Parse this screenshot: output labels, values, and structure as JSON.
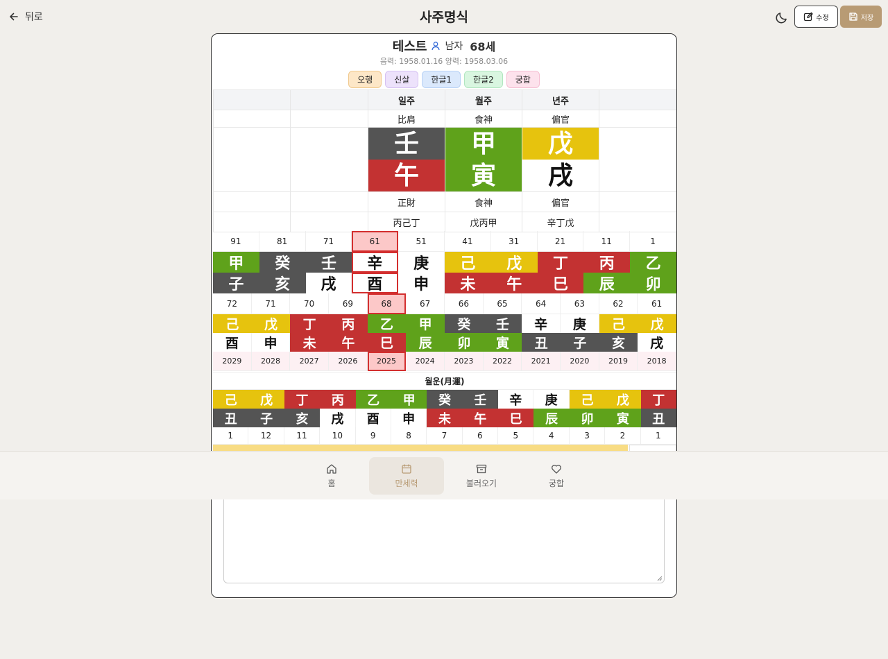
{
  "header": {
    "back_label": "뒤로",
    "title": "사주명식",
    "edit_label": "수정",
    "save_label": "저장"
  },
  "profile": {
    "name": "테스트",
    "gender": "남자",
    "age": "68세",
    "dates": "음력: 1958.01.16 양력: 1958.03.06"
  },
  "tabs": [
    {
      "label": "오행",
      "bg": "#fde7c7",
      "border": "#f0c98d"
    },
    {
      "label": "신살",
      "bg": "#ede2fb",
      "border": "#d6c2f2"
    },
    {
      "label": "한글1",
      "bg": "#dbe9fc",
      "border": "#b8d2f5"
    },
    {
      "label": "한글2",
      "bg": "#d9f6e0",
      "border": "#b2e6c0"
    },
    {
      "label": "궁합",
      "bg": "#fde2ec",
      "border": "#f5bed2"
    }
  ],
  "pillars": {
    "headers": [
      "",
      "",
      "일주",
      "월주",
      "년주",
      ""
    ],
    "top_gods": [
      "比肩",
      "食神",
      "偏官"
    ],
    "stems": [
      {
        "ch": "壬",
        "bg": "#545454",
        "fg": "#ffffff"
      },
      {
        "ch": "甲",
        "bg": "#5fa21b",
        "fg": "#ffffff"
      },
      {
        "ch": "戊",
        "bg": "#e6c30e",
        "fg": "#ffffff"
      }
    ],
    "branches": [
      {
        "ch": "午",
        "bg": "#c33232",
        "fg": "#ffffff"
      },
      {
        "ch": "寅",
        "bg": "#5fa21b",
        "fg": "#ffffff"
      },
      {
        "ch": "戌",
        "bg": "#ffffff",
        "fg": "#111111"
      }
    ],
    "bottom_gods": [
      "正財",
      "食神",
      "偏官"
    ],
    "hidden": [
      "丙己丁",
      "戊丙甲",
      "辛丁戊"
    ]
  },
  "daeun": {
    "ages": [
      "91",
      "81",
      "71",
      "61",
      "51",
      "41",
      "31",
      "21",
      "11",
      "1"
    ],
    "selected_index": 3,
    "stems": [
      {
        "ch": "甲",
        "bg": "#5fa21b",
        "fg": "#ffffff"
      },
      {
        "ch": "癸",
        "bg": "#545454",
        "fg": "#ffffff"
      },
      {
        "ch": "壬",
        "bg": "#545454",
        "fg": "#ffffff"
      },
      {
        "ch": "辛",
        "bg": "#ffffff",
        "fg": "#111111"
      },
      {
        "ch": "庚",
        "bg": "#ffffff",
        "fg": "#111111"
      },
      {
        "ch": "己",
        "bg": "#e6c30e",
        "fg": "#ffffff"
      },
      {
        "ch": "戊",
        "bg": "#e6c30e",
        "fg": "#ffffff"
      },
      {
        "ch": "丁",
        "bg": "#c33232",
        "fg": "#ffffff"
      },
      {
        "ch": "丙",
        "bg": "#c33232",
        "fg": "#ffffff"
      },
      {
        "ch": "乙",
        "bg": "#5fa21b",
        "fg": "#ffffff"
      }
    ],
    "branches": [
      {
        "ch": "子",
        "bg": "#545454",
        "fg": "#ffffff"
      },
      {
        "ch": "亥",
        "bg": "#545454",
        "fg": "#ffffff"
      },
      {
        "ch": "戌",
        "bg": "#ffffff",
        "fg": "#111111"
      },
      {
        "ch": "酉",
        "bg": "#ffffff",
        "fg": "#111111"
      },
      {
        "ch": "申",
        "bg": "#ffffff",
        "fg": "#111111"
      },
      {
        "ch": "未",
        "bg": "#c33232",
        "fg": "#ffffff"
      },
      {
        "ch": "午",
        "bg": "#c33232",
        "fg": "#ffffff"
      },
      {
        "ch": "巳",
        "bg": "#c33232",
        "fg": "#ffffff"
      },
      {
        "ch": "辰",
        "bg": "#5fa21b",
        "fg": "#ffffff"
      },
      {
        "ch": "卯",
        "bg": "#5fa21b",
        "fg": "#ffffff"
      }
    ]
  },
  "seun": {
    "ages": [
      "72",
      "71",
      "70",
      "69",
      "68",
      "67",
      "66",
      "65",
      "64",
      "63",
      "62",
      "61"
    ],
    "selected_index": 4,
    "stems": [
      {
        "ch": "己",
        "bg": "#e6c30e",
        "fg": "#ffffff"
      },
      {
        "ch": "戊",
        "bg": "#e6c30e",
        "fg": "#ffffff"
      },
      {
        "ch": "丁",
        "bg": "#c33232",
        "fg": "#ffffff"
      },
      {
        "ch": "丙",
        "bg": "#c33232",
        "fg": "#ffffff"
      },
      {
        "ch": "乙",
        "bg": "#5fa21b",
        "fg": "#ffffff"
      },
      {
        "ch": "甲",
        "bg": "#5fa21b",
        "fg": "#ffffff"
      },
      {
        "ch": "癸",
        "bg": "#545454",
        "fg": "#ffffff"
      },
      {
        "ch": "壬",
        "bg": "#545454",
        "fg": "#ffffff"
      },
      {
        "ch": "辛",
        "bg": "#ffffff",
        "fg": "#111111"
      },
      {
        "ch": "庚",
        "bg": "#ffffff",
        "fg": "#111111"
      },
      {
        "ch": "己",
        "bg": "#e6c30e",
        "fg": "#ffffff"
      },
      {
        "ch": "戊",
        "bg": "#e6c30e",
        "fg": "#ffffff"
      }
    ],
    "branches": [
      {
        "ch": "酉",
        "bg": "#ffffff",
        "fg": "#111111"
      },
      {
        "ch": "申",
        "bg": "#ffffff",
        "fg": "#111111"
      },
      {
        "ch": "未",
        "bg": "#c33232",
        "fg": "#ffffff"
      },
      {
        "ch": "午",
        "bg": "#c33232",
        "fg": "#ffffff"
      },
      {
        "ch": "巳",
        "bg": "#c33232",
        "fg": "#ffffff"
      },
      {
        "ch": "辰",
        "bg": "#5fa21b",
        "fg": "#ffffff"
      },
      {
        "ch": "卯",
        "bg": "#5fa21b",
        "fg": "#ffffff"
      },
      {
        "ch": "寅",
        "bg": "#5fa21b",
        "fg": "#ffffff"
      },
      {
        "ch": "丑",
        "bg": "#545454",
        "fg": "#ffffff"
      },
      {
        "ch": "子",
        "bg": "#545454",
        "fg": "#ffffff"
      },
      {
        "ch": "亥",
        "bg": "#545454",
        "fg": "#ffffff"
      },
      {
        "ch": "戌",
        "bg": "#ffffff",
        "fg": "#111111"
      }
    ],
    "years": [
      "2029",
      "2028",
      "2027",
      "2026",
      "2025",
      "2024",
      "2023",
      "2022",
      "2021",
      "2020",
      "2019",
      "2018"
    ]
  },
  "wolun": {
    "label": "월운(月運)",
    "stems": [
      {
        "ch": "己",
        "bg": "#e6c30e",
        "fg": "#ffffff"
      },
      {
        "ch": "戊",
        "bg": "#e6c30e",
        "fg": "#ffffff"
      },
      {
        "ch": "丁",
        "bg": "#c33232",
        "fg": "#ffffff"
      },
      {
        "ch": "丙",
        "bg": "#c33232",
        "fg": "#ffffff"
      },
      {
        "ch": "乙",
        "bg": "#5fa21b",
        "fg": "#ffffff"
      },
      {
        "ch": "甲",
        "bg": "#5fa21b",
        "fg": "#ffffff"
      },
      {
        "ch": "癸",
        "bg": "#545454",
        "fg": "#ffffff"
      },
      {
        "ch": "壬",
        "bg": "#545454",
        "fg": "#ffffff"
      },
      {
        "ch": "辛",
        "bg": "#ffffff",
        "fg": "#111111"
      },
      {
        "ch": "庚",
        "bg": "#ffffff",
        "fg": "#111111"
      },
      {
        "ch": "己",
        "bg": "#e6c30e",
        "fg": "#ffffff"
      },
      {
        "ch": "戊",
        "bg": "#e6c30e",
        "fg": "#ffffff"
      },
      {
        "ch": "丁",
        "bg": "#c33232",
        "fg": "#ffffff"
      }
    ],
    "branches": [
      {
        "ch": "丑",
        "bg": "#545454",
        "fg": "#ffffff"
      },
      {
        "ch": "子",
        "bg": "#545454",
        "fg": "#ffffff"
      },
      {
        "ch": "亥",
        "bg": "#545454",
        "fg": "#ffffff"
      },
      {
        "ch": "戌",
        "bg": "#ffffff",
        "fg": "#111111"
      },
      {
        "ch": "酉",
        "bg": "#ffffff",
        "fg": "#111111"
      },
      {
        "ch": "申",
        "bg": "#ffffff",
        "fg": "#111111"
      },
      {
        "ch": "未",
        "bg": "#c33232",
        "fg": "#ffffff"
      },
      {
        "ch": "午",
        "bg": "#c33232",
        "fg": "#ffffff"
      },
      {
        "ch": "巳",
        "bg": "#c33232",
        "fg": "#ffffff"
      },
      {
        "ch": "辰",
        "bg": "#5fa21b",
        "fg": "#ffffff"
      },
      {
        "ch": "卯",
        "bg": "#5fa21b",
        "fg": "#ffffff"
      },
      {
        "ch": "寅",
        "bg": "#5fa21b",
        "fg": "#ffffff"
      },
      {
        "ch": "丑",
        "bg": "#545454",
        "fg": "#ffffff"
      }
    ],
    "months": [
      "1",
      "12",
      "11",
      "10",
      "9",
      "8",
      "7",
      "6",
      "5",
      "4",
      "3",
      "2",
      "1"
    ]
  },
  "nav": [
    {
      "label": "홈",
      "icon": "home-icon"
    },
    {
      "label": "만세력",
      "icon": "calendar-icon"
    },
    {
      "label": "불러오기",
      "icon": "archive-icon"
    },
    {
      "label": "궁합",
      "icon": "heart-icon"
    }
  ],
  "nav_active_index": 1,
  "colors": {
    "accent": "#b89b74",
    "selected_outline": "#d32f2f",
    "selected_bg": "#fcc8c8",
    "year_row_bg": "#fdf0f3"
  }
}
